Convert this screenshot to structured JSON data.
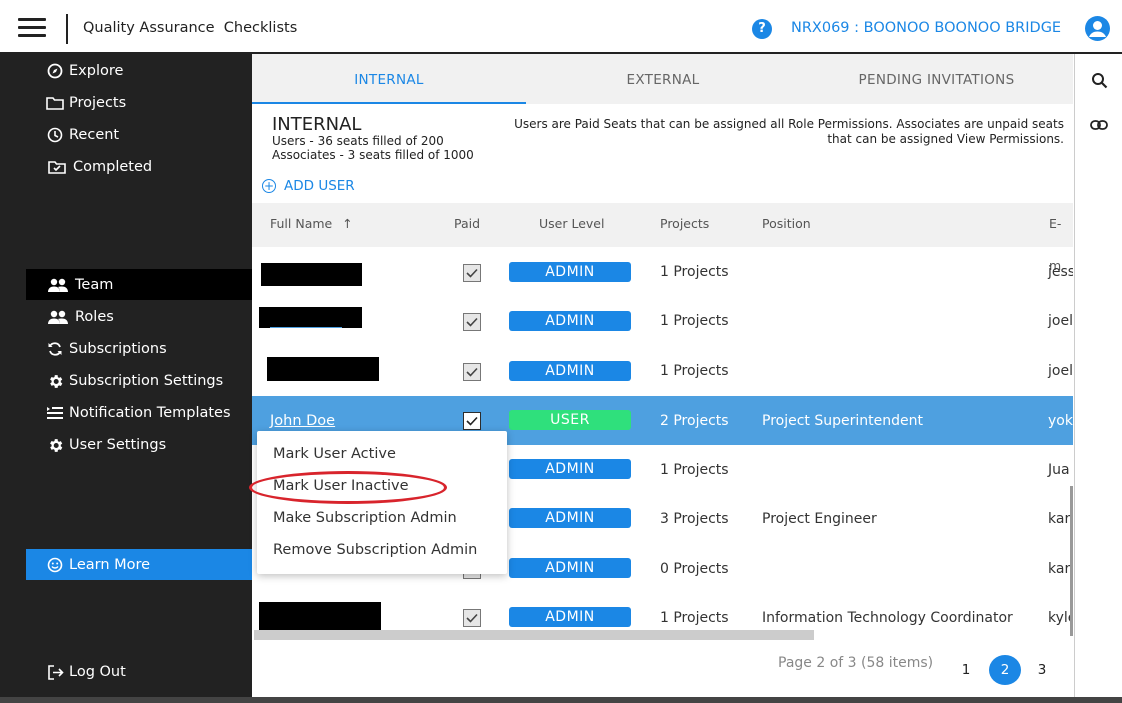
{
  "header": {
    "app_title": "Quality Assurance  Checklists",
    "project_name": "NRX069 : BOONOO BOONOO BRIDGE",
    "help_glyph": "?"
  },
  "sidebar": {
    "items": [
      {
        "label": "Explore",
        "icon": "compass-icon"
      },
      {
        "label": "Projects",
        "icon": "folder-icon"
      },
      {
        "label": "Recent",
        "icon": "clock-icon"
      },
      {
        "label": "Completed",
        "icon": "folder-check-icon"
      },
      {
        "label": "Team",
        "icon": "people-icon",
        "active": true
      },
      {
        "label": "Roles",
        "icon": "people-icon"
      },
      {
        "label": "Subscriptions",
        "icon": "refresh-icon"
      },
      {
        "label": "Subscription Settings",
        "icon": "gear-icon"
      },
      {
        "label": "Notification Templates",
        "icon": "list-icon"
      },
      {
        "label": "User Settings",
        "icon": "gear-icon"
      }
    ],
    "learn_more": "Learn More",
    "logout": "Log Out"
  },
  "tabs": [
    {
      "label": "INTERNAL",
      "active": true
    },
    {
      "label": "EXTERNAL",
      "active": false
    },
    {
      "label": "PENDING INVITATIONS",
      "active": false
    }
  ],
  "section": {
    "title": "INTERNAL",
    "users_line": "Users - 36 seats filled of 200",
    "associates_line": "Associates - 3 seats filled of 1000",
    "info": "Users are Paid Seats that can be assigned all Role Permissions. Associates are unpaid seats that can be assigned View Permissions.",
    "add_user": "ADD USER"
  },
  "table": {
    "columns": [
      "Full Name",
      "Paid",
      "User Level",
      "Projects",
      "Position",
      "E-m"
    ],
    "sort_arrow": "↑",
    "rows": [
      {
        "name": "",
        "paid": true,
        "level": "ADMIN",
        "projects": "1 Projects",
        "position": "",
        "email": "jess"
      },
      {
        "name": "",
        "paid": true,
        "level": "ADMIN",
        "projects": "1 Projects",
        "position": "",
        "email": "joel"
      },
      {
        "name": "",
        "paid": true,
        "level": "ADMIN",
        "projects": "1 Projects",
        "position": "",
        "email": "joel"
      },
      {
        "name": "John Doe",
        "paid": true,
        "level": "USER",
        "projects": "2 Projects",
        "position": "Project Superintendent",
        "email": "yok",
        "selected": true
      },
      {
        "name": "",
        "paid": true,
        "level": "ADMIN",
        "projects": "1 Projects",
        "position": "",
        "email": "Jua"
      },
      {
        "name": "",
        "paid": true,
        "level": "ADMIN",
        "projects": "3 Projects",
        "position": "Project Engineer",
        "email": "kar"
      },
      {
        "name": "",
        "paid": true,
        "level": "ADMIN",
        "projects": "0 Projects",
        "position": "",
        "email": "kar"
      },
      {
        "name": "",
        "paid": true,
        "level": "ADMIN",
        "projects": "1 Projects",
        "position": "Information Technology Coordinator",
        "email": "kyle"
      }
    ]
  },
  "pagination": {
    "summary": "Page 2 of 3 (58 items)",
    "pages": [
      "1",
      "2",
      "3"
    ],
    "current": "2"
  },
  "context_menu": {
    "items": [
      "Mark User Active",
      "Mark User Inactive",
      "Make Subscription Admin",
      "Remove Subscription Admin"
    ],
    "highlighted": "Mark User Inactive"
  },
  "colors": {
    "accent": "#1b87e5",
    "sidebar_bg": "#222222",
    "selected_row": "#4ea0e0",
    "user_badge": "#2fe07c",
    "annotation": "#d8242c"
  }
}
